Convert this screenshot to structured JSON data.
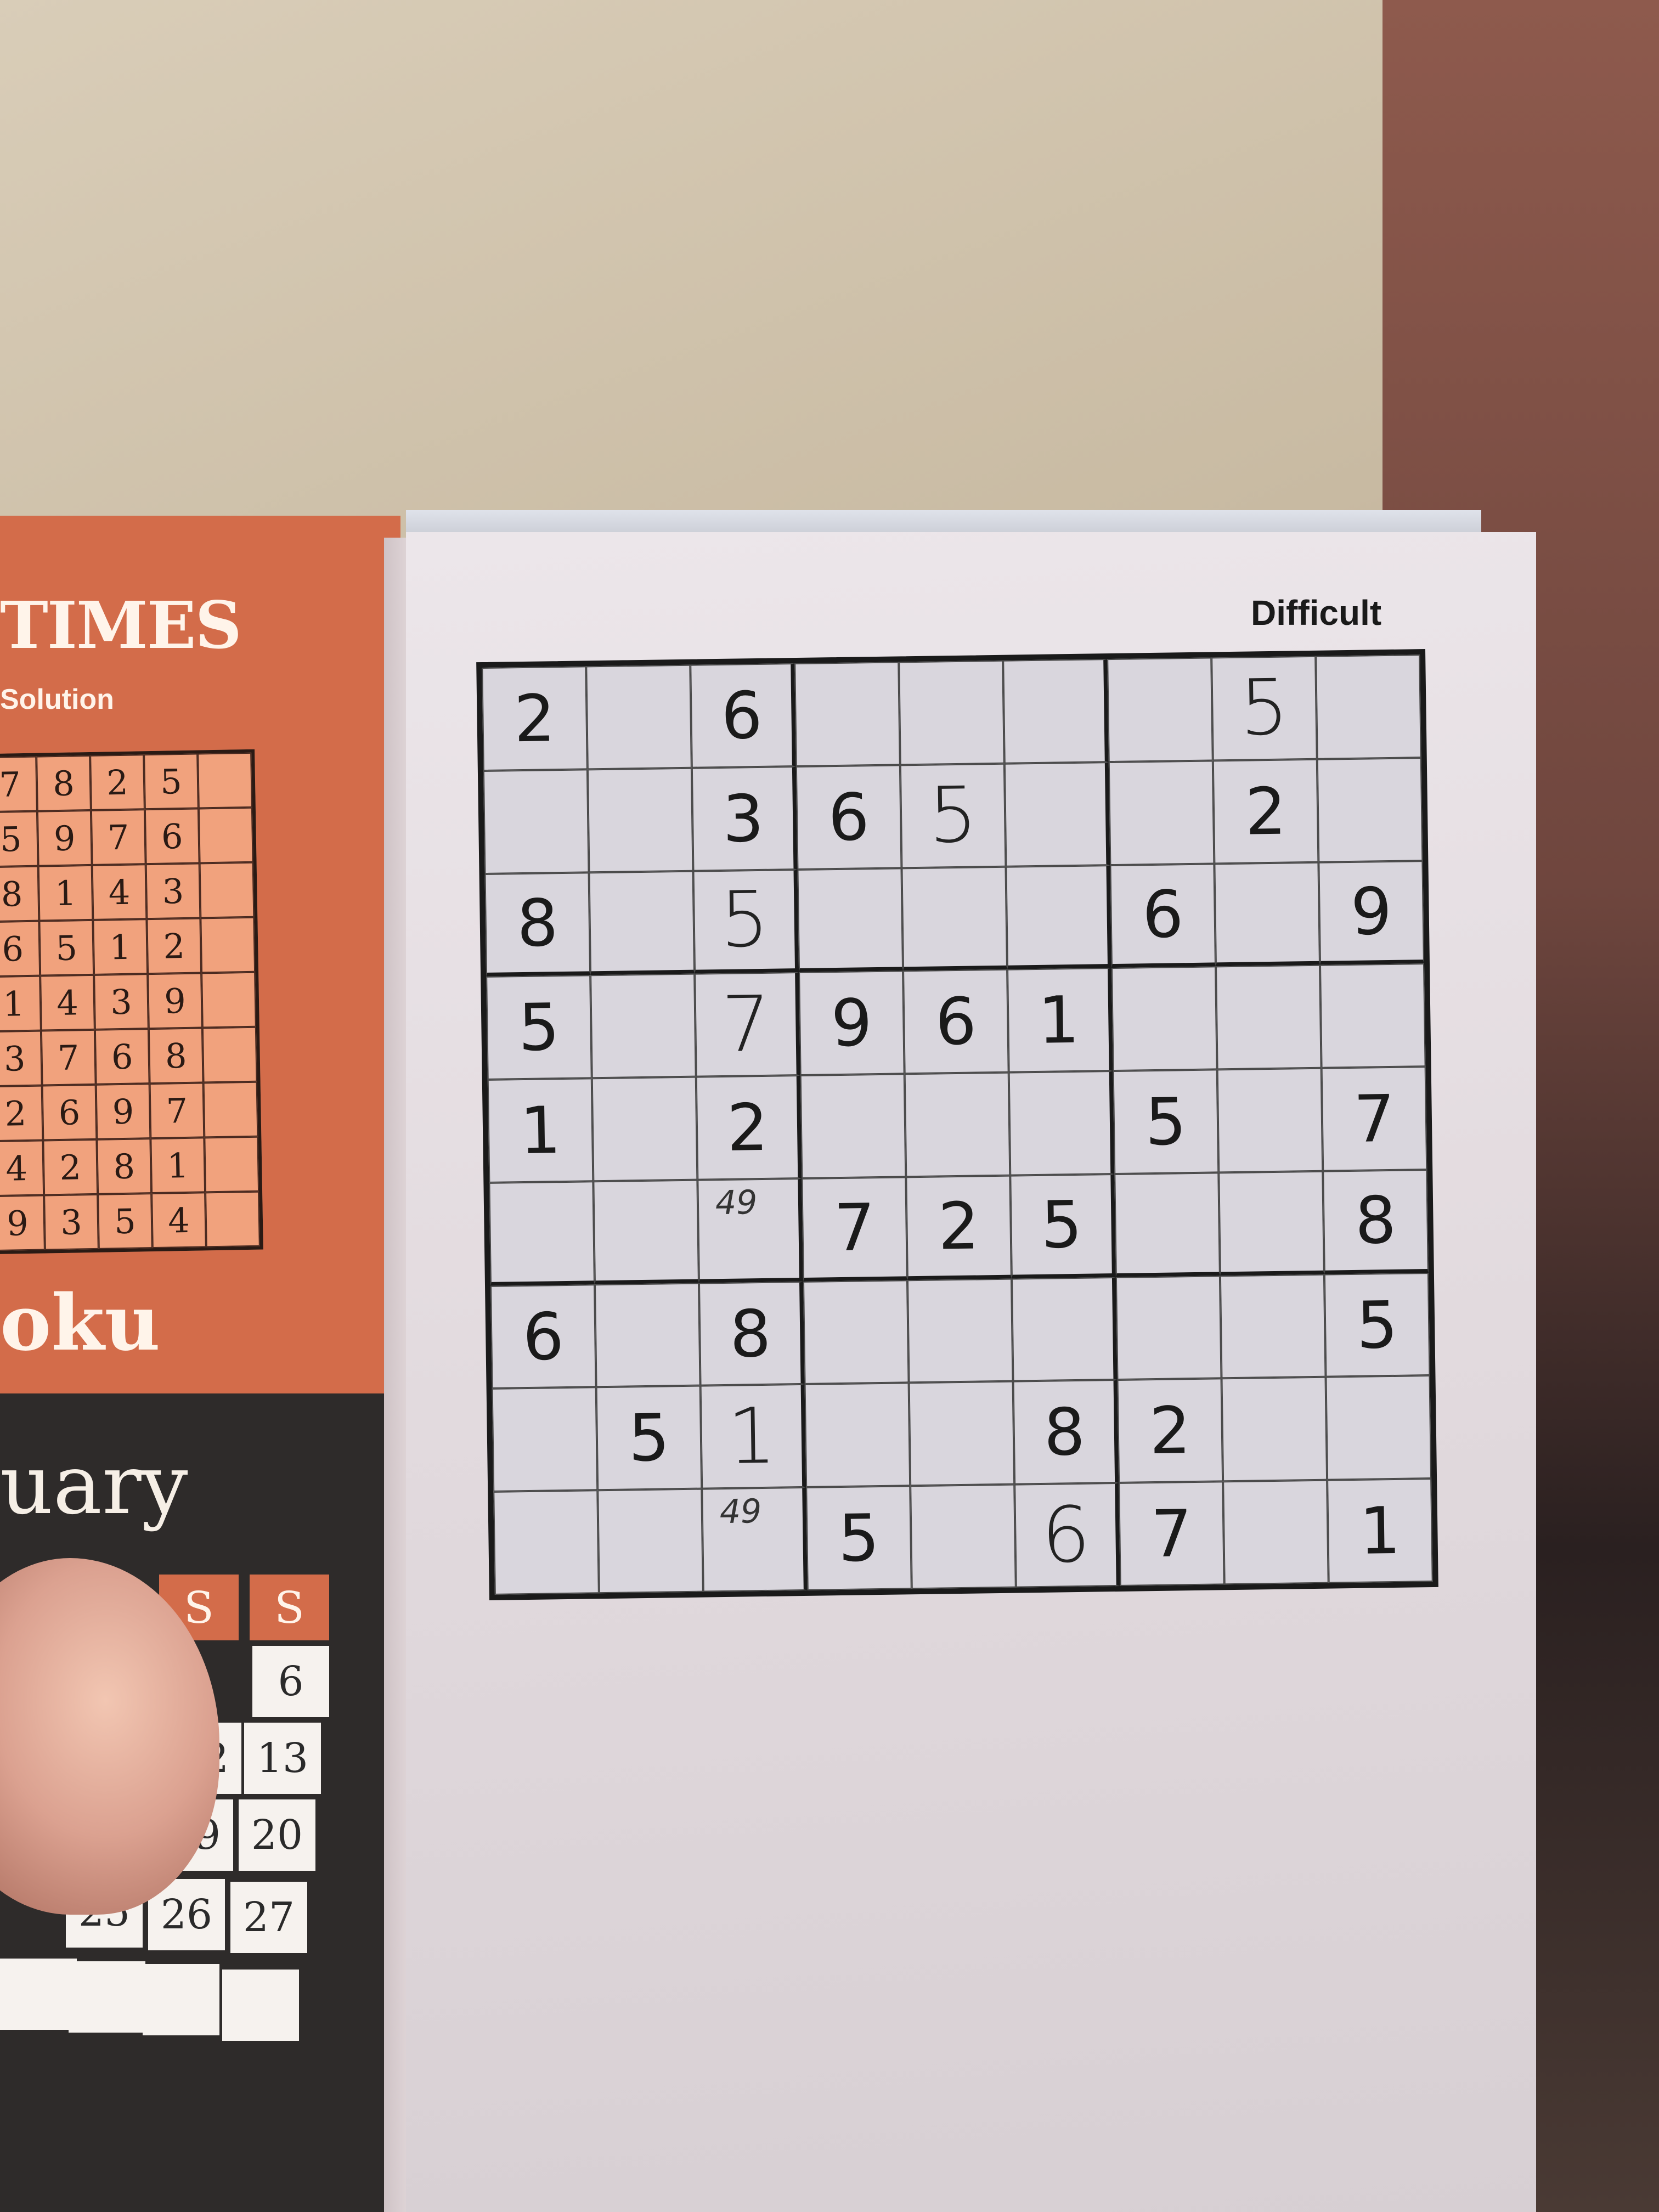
{
  "left_page": {
    "masthead": "TIMES",
    "solution_label": "Solution",
    "solution_grid": [
      [
        "7",
        "8",
        "2",
        "5",
        ""
      ],
      [
        "5",
        "9",
        "7",
        "6",
        ""
      ],
      [
        "8",
        "1",
        "4",
        "3",
        ""
      ],
      [
        "6",
        "5",
        "1",
        "2",
        ""
      ],
      [
        "1",
        "4",
        "3",
        "9",
        ""
      ],
      [
        "3",
        "7",
        "6",
        "8",
        ""
      ],
      [
        "2",
        "6",
        "9",
        "7",
        ""
      ],
      [
        "4",
        "2",
        "8",
        "1",
        ""
      ],
      [
        "9",
        "3",
        "5",
        "4",
        ""
      ]
    ],
    "puzzle_title_fragment": "oku",
    "calendar": {
      "month_fragment": "uary",
      "headers": [
        "S",
        "S"
      ],
      "dates": [
        "6",
        "12",
        "13",
        "19",
        "20",
        "25",
        "26",
        "27"
      ]
    }
  },
  "right_page": {
    "difficulty": "Difficult",
    "grid": [
      [
        "2",
        "",
        "6",
        "",
        "",
        "",
        "",
        "5",
        ""
      ],
      [
        "",
        "",
        "3",
        "6",
        "5",
        "",
        "",
        "2",
        ""
      ],
      [
        "8",
        "",
        "5",
        "",
        "",
        "",
        "6",
        "",
        "9"
      ],
      [
        "5",
        "",
        "7",
        "9",
        "6",
        "1",
        "",
        "",
        ""
      ],
      [
        "1",
        "",
        "2",
        "",
        "",
        "",
        "5",
        "",
        "7"
      ],
      [
        "",
        "",
        "",
        "7",
        "2",
        "5",
        "",
        "",
        "8"
      ],
      [
        "6",
        "",
        "8",
        "",
        "",
        "",
        "",
        "",
        "5"
      ],
      [
        "",
        "5",
        "1",
        "",
        "",
        "8",
        "2",
        "",
        ""
      ],
      [
        "",
        "",
        "",
        "5",
        "",
        "6",
        "7",
        "",
        "1"
      ]
    ],
    "notes": {
      "5-2": "49",
      "8-2": "49"
    }
  },
  "colors": {
    "left_page_accent": "#d36c4a",
    "calendar_panel": "#2e2b2a",
    "grid_border": "#1a1a1a"
  }
}
